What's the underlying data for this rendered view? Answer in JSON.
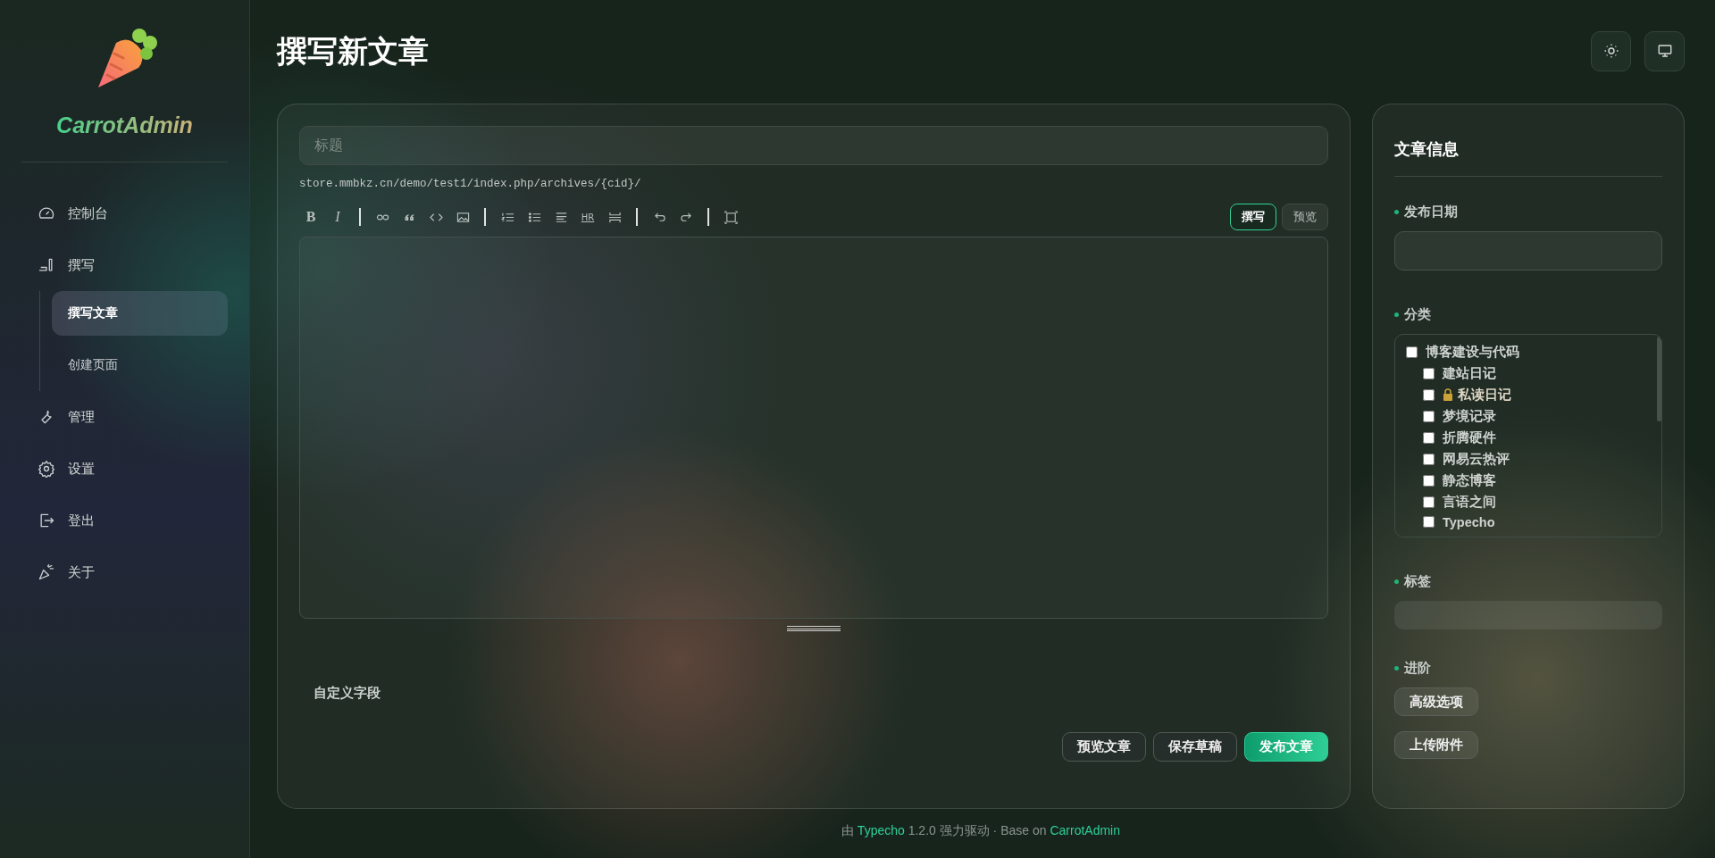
{
  "sidebar": {
    "brand": "CarrotAdmin",
    "items": [
      {
        "label": "控制台",
        "selected": false
      },
      {
        "label": "撰写",
        "selected": false,
        "children": [
          {
            "label": "撰写文章",
            "selected": true
          },
          {
            "label": "创建页面",
            "selected": false
          }
        ]
      },
      {
        "label": "管理",
        "selected": false
      },
      {
        "label": "设置",
        "selected": false
      },
      {
        "label": "登出",
        "selected": false
      },
      {
        "label": "关于",
        "selected": false
      }
    ]
  },
  "header": {
    "title": "撰写新文章"
  },
  "editor": {
    "title_placeholder": "标题",
    "permalink": "store.mmbkz.cn/demo/test1/index.php/archives/{cid}/",
    "toolbar": [
      {
        "kind": "text",
        "label": "B"
      },
      {
        "kind": "text",
        "label": "I"
      },
      {
        "kind": "sep"
      },
      {
        "kind": "icon"
      },
      {
        "kind": "icon"
      },
      {
        "kind": "icon"
      },
      {
        "kind": "icon"
      },
      {
        "kind": "sep"
      },
      {
        "kind": "icon"
      },
      {
        "kind": "icon"
      },
      {
        "kind": "icon"
      },
      {
        "kind": "text",
        "label": "HR"
      },
      {
        "kind": "icon"
      },
      {
        "kind": "sep"
      },
      {
        "kind": "icon"
      },
      {
        "kind": "icon"
      },
      {
        "kind": "sep"
      },
      {
        "kind": "icon"
      }
    ],
    "modes": [
      {
        "label": "撰写",
        "selected": true
      },
      {
        "label": "预览",
        "selected": false
      }
    ],
    "custom_fields": "自定义字段",
    "buttons": [
      {
        "label": "预览文章",
        "primary": false
      },
      {
        "label": "保存草稿",
        "primary": false
      },
      {
        "label": "发布文章",
        "primary": true
      }
    ]
  },
  "info": {
    "title": "文章信息",
    "date_label": "发布日期",
    "category_label": "分类",
    "categories": [
      {
        "label": "博客建设与代码",
        "checked": false,
        "locked": false,
        "children": [
          {
            "label": "建站日记",
            "checked": false,
            "locked": false
          },
          {
            "label": "私读日记",
            "checked": false,
            "locked": true
          },
          {
            "label": "梦境记录",
            "checked": false,
            "locked": false
          },
          {
            "label": "折腾硬件",
            "checked": false,
            "locked": false
          },
          {
            "label": "网易云热评",
            "checked": false,
            "locked": false
          },
          {
            "label": "静态博客",
            "checked": false,
            "locked": false
          },
          {
            "label": "言语之间",
            "checked": false,
            "locked": false
          },
          {
            "label": "Typecho",
            "checked": false,
            "locked": false
          }
        ]
      }
    ],
    "tags_label": "标签",
    "advanced_label": "进阶",
    "advanced_buttons": [
      "高级选项",
      "上传附件"
    ]
  },
  "footer": {
    "parts": [
      {
        "text": "由 ",
        "link": false
      },
      {
        "text": "Typecho",
        "link": true
      },
      {
        "text": " 1.2.0 强力驱动 · Base on ",
        "link": false
      },
      {
        "text": "CarrotAdmin",
        "link": true
      }
    ]
  }
}
